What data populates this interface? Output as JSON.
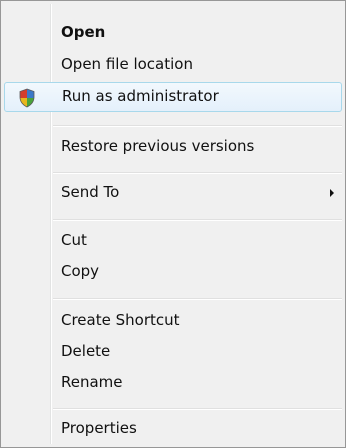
{
  "context_menu": {
    "items": [
      {
        "label": "Open",
        "bold": true
      },
      {
        "label": "Open file location"
      },
      {
        "label": "Run as administrator",
        "icon": "uac-shield-icon",
        "highlighted": true
      },
      {
        "label": "Restore previous versions"
      },
      {
        "label": "Send To",
        "submenu": true
      },
      {
        "label": "Cut"
      },
      {
        "label": "Copy"
      },
      {
        "label": "Create Shortcut"
      },
      {
        "label": "Delete"
      },
      {
        "label": "Rename"
      },
      {
        "label": "Properties"
      }
    ]
  },
  "colors": {
    "menu_background": "#f0f0f0",
    "menu_border": "#979797",
    "highlight_border": "#a8d8eb",
    "highlight_fill": "#e4f0fb"
  }
}
